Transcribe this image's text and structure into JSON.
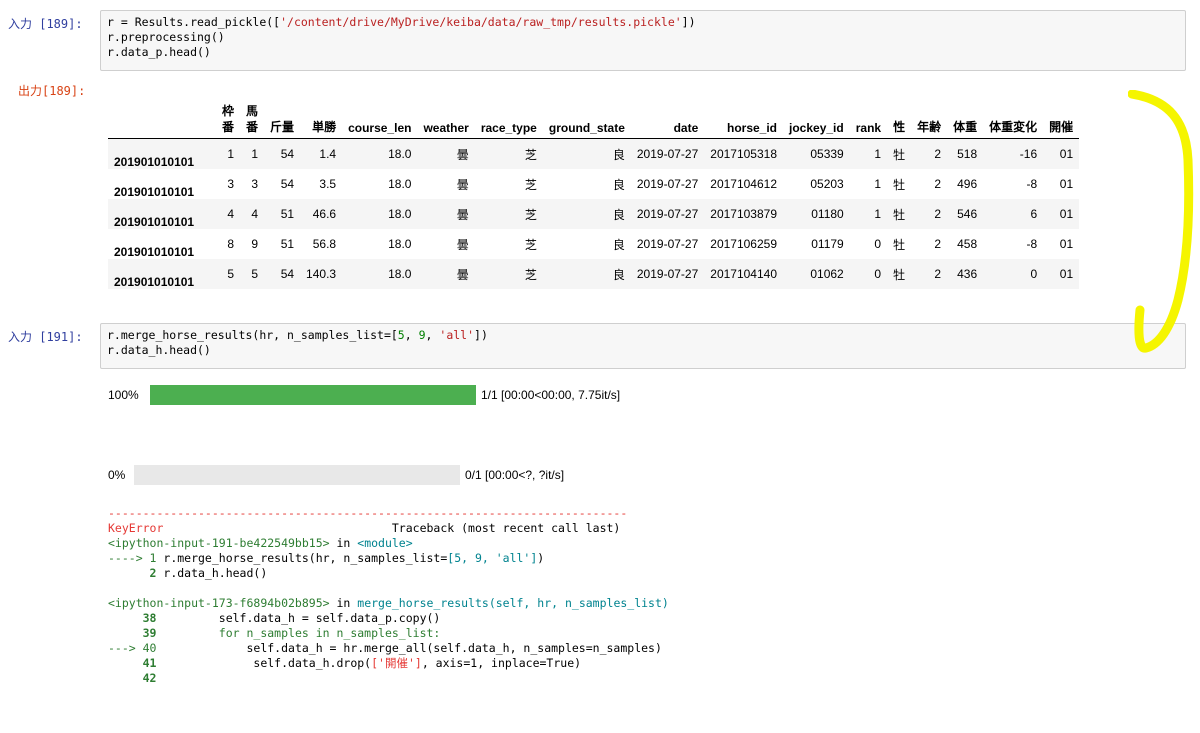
{
  "cells": {
    "in1": {
      "prompt": "入力 [189]:",
      "line1_pre": "r = Results.read_pickle([",
      "line1_str": "'/content/drive/MyDrive/keiba/data/raw_tmp/results.pickle'",
      "line1_post": "])",
      "line2": "r.preprocessing()",
      "line3": "r.data_p.head()"
    },
    "out1": {
      "prompt": "出力[189]:"
    },
    "in2": {
      "prompt": "入力 [191]:",
      "line1_pre": "r.merge_horse_results(hr, n_samples_list=[",
      "line1_n1": "5",
      "line1_sep1": ", ",
      "line1_n2": "9",
      "line1_sep2": ", ",
      "line1_str": "'all'",
      "line1_post": "])",
      "line2": "r.data_h.head()"
    }
  },
  "table": {
    "columns": [
      "",
      "枠番",
      "馬番",
      "斤量",
      "単勝",
      "course_len",
      "weather",
      "race_type",
      "ground_state",
      "date",
      "horse_id",
      "jockey_id",
      "rank",
      "性",
      "年齢",
      "体重",
      "体重変化",
      "開催"
    ],
    "stacked": {
      "waku": [
        "枠",
        "番"
      ],
      "uma": [
        "馬",
        "番"
      ]
    },
    "rows": [
      [
        "201901010101",
        "1",
        "1",
        "54",
        "1.4",
        "18.0",
        "曇",
        "芝",
        "良",
        "2019-07-27",
        "2017105318",
        "05339",
        "1",
        "牡",
        "2",
        "518",
        "-16",
        "01"
      ],
      [
        "201901010101",
        "3",
        "3",
        "54",
        "3.5",
        "18.0",
        "曇",
        "芝",
        "良",
        "2019-07-27",
        "2017104612",
        "05203",
        "1",
        "牡",
        "2",
        "496",
        "-8",
        "01"
      ],
      [
        "201901010101",
        "4",
        "4",
        "51",
        "46.6",
        "18.0",
        "曇",
        "芝",
        "良",
        "2019-07-27",
        "2017103879",
        "01180",
        "1",
        "牡",
        "2",
        "546",
        "6",
        "01"
      ],
      [
        "201901010101",
        "8",
        "9",
        "51",
        "56.8",
        "18.0",
        "曇",
        "芝",
        "良",
        "2019-07-27",
        "2017106259",
        "01179",
        "0",
        "牡",
        "2",
        "458",
        "-8",
        "01"
      ],
      [
        "201901010101",
        "5",
        "5",
        "54",
        "140.3",
        "18.0",
        "曇",
        "芝",
        "良",
        "2019-07-27",
        "2017104140",
        "01062",
        "0",
        "牡",
        "2",
        "436",
        "0",
        "01"
      ]
    ]
  },
  "progress": [
    {
      "percent_label": "100%",
      "fraction": 1.0,
      "status": "1/1 [00:00<00:00, 7.75it/s]"
    },
    {
      "percent_label": "0%",
      "fraction": 0.0,
      "status": "0/1 [00:00<?, ?it/s]"
    }
  ],
  "traceback": {
    "dashes": "---------------------------------------------------------------------------",
    "error_name": "KeyError",
    "header_right": "Traceback (most recent call last)",
    "frame1_file": "<ipython-input-191-be422549bb15>",
    "frame1_in": " in ",
    "frame1_func": "<module>",
    "f1_arrow": "----> 1 ",
    "f1_code_pre": "r.merge_horse_results(hr, n_samples_list=",
    "f1_code_list": "[5, 9, 'all']",
    "f1_code_post": ")",
    "f1_l2_no": "      2 ",
    "f1_l2_code": "r.data_h.head()",
    "frame2_file": "<ipython-input-173-f6894b02b895>",
    "frame2_in": " in ",
    "frame2_func": "merge_horse_results(self, hr, n_samples_list)",
    "l38_no": "     38 ",
    "l38_code": "        self.data_h = self.data_p.copy()",
    "l39_no": "     39 ",
    "l39_code": "        for n_samples in n_samples_list:",
    "l40_arrow": "---> 40 ",
    "l40_code": "            self.data_h = hr.merge_all(self.data_h, n_samples=n_samples)",
    "l41_no": "     41 ",
    "l41_code_pre": "             self.data_h.drop(",
    "l41_code_str": "['開催']",
    "l41_code_post": ", axis=1, inplace=True)",
    "l42_no": "     42 "
  },
  "annotation": {
    "color": "#f5f500",
    "shape": "yellow-hand-drawn-ellipse"
  }
}
